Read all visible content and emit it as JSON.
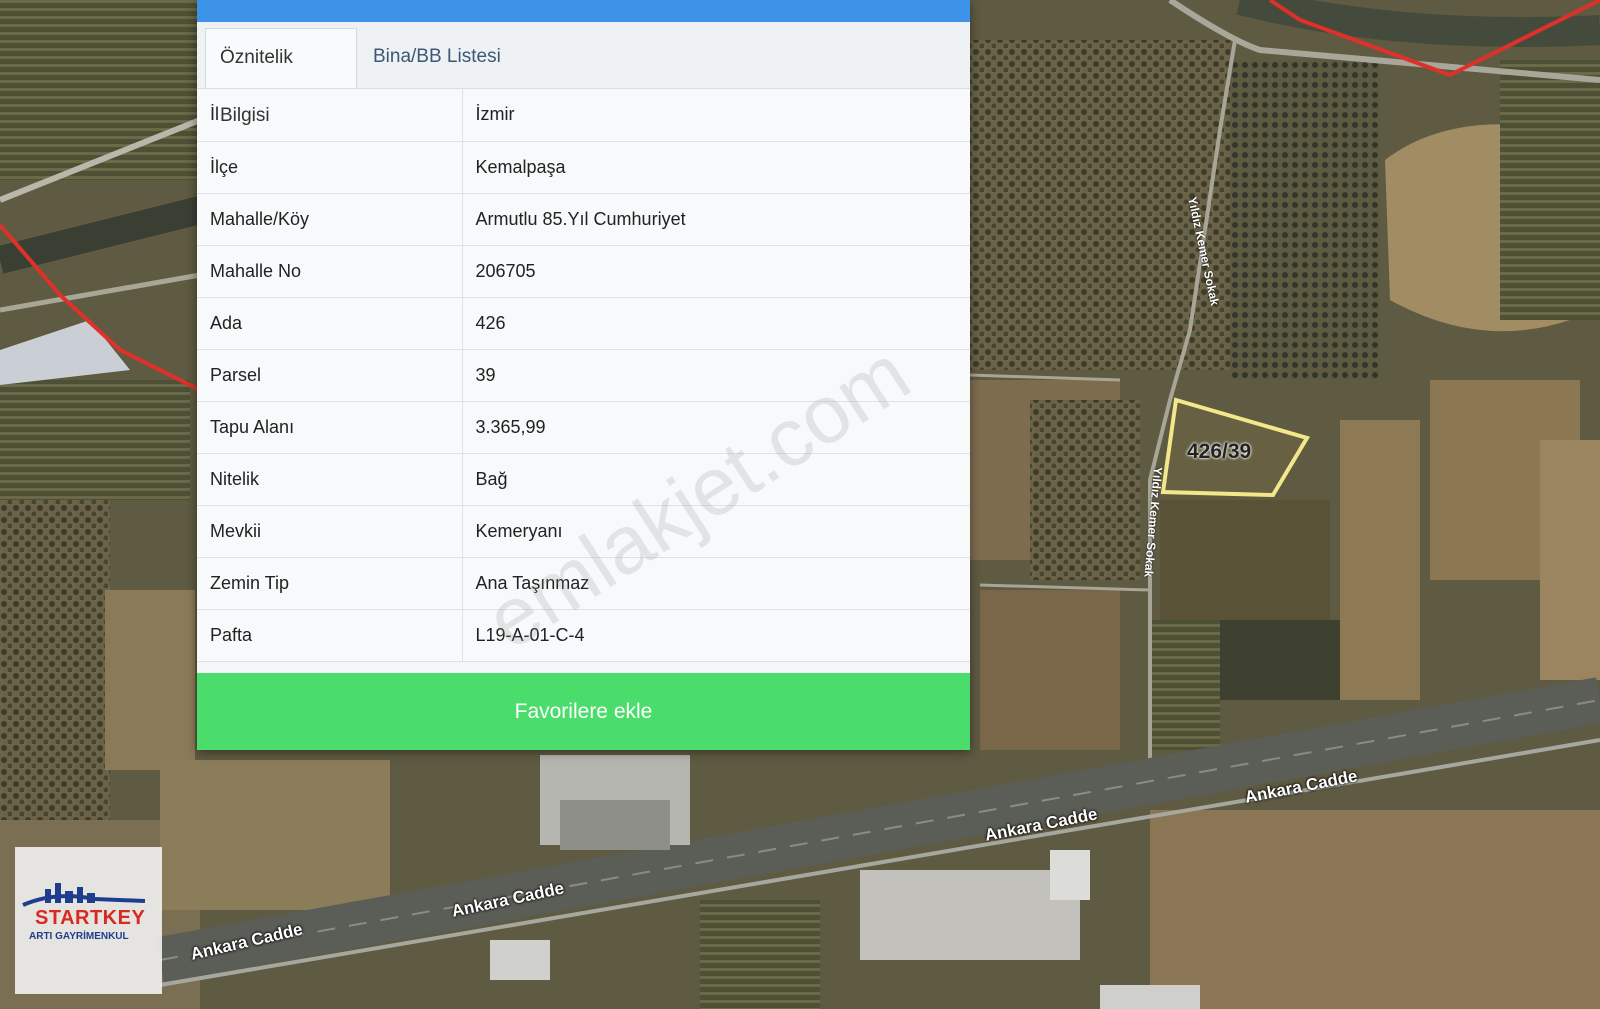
{
  "panel": {
    "tabs": [
      {
        "label": "Öznitelik Bilgisi",
        "active": true
      },
      {
        "label": "Bina/BB Listesi",
        "active": false
      }
    ],
    "rows": [
      {
        "key": "İl",
        "value": "İzmir"
      },
      {
        "key": "İlçe",
        "value": "Kemalpaşa"
      },
      {
        "key": "Mahalle/Köy",
        "value": "Armutlu 85.Yıl Cumhuriyet"
      },
      {
        "key": "Mahalle No",
        "value": "206705"
      },
      {
        "key": "Ada",
        "value": "426"
      },
      {
        "key": "Parsel",
        "value": "39"
      },
      {
        "key": "Tapu Alanı",
        "value": "3.365,99"
      },
      {
        "key": "Nitelik",
        "value": "Bağ"
      },
      {
        "key": "Mevkii",
        "value": "Kemeryanı"
      },
      {
        "key": "Zemin Tip",
        "value": "Ana Taşınmaz"
      },
      {
        "key": "Pafta",
        "value": "L19-A-01-C-4"
      }
    ],
    "favorite_button": "Favorilere ekle",
    "header_color": "#3d93e8",
    "button_color": "#4bdd6b"
  },
  "watermark": "emlakjet.com",
  "map": {
    "parcel_label": "426/39",
    "road_labels": [
      "Ankara Cadde",
      "Ankara Cadde",
      "Ankara Cadde",
      "Ankara Cadde"
    ],
    "street_labels": [
      "Yıldız Kemer Sokak",
      "Yıldız Kemer Sokak"
    ],
    "parcel_outline_color": "#f2e88a",
    "boundary_color": "#e0302a"
  },
  "logo": {
    "brand": "STARTKEY",
    "subtitle": "ARTI GAYRİMENKUL"
  }
}
